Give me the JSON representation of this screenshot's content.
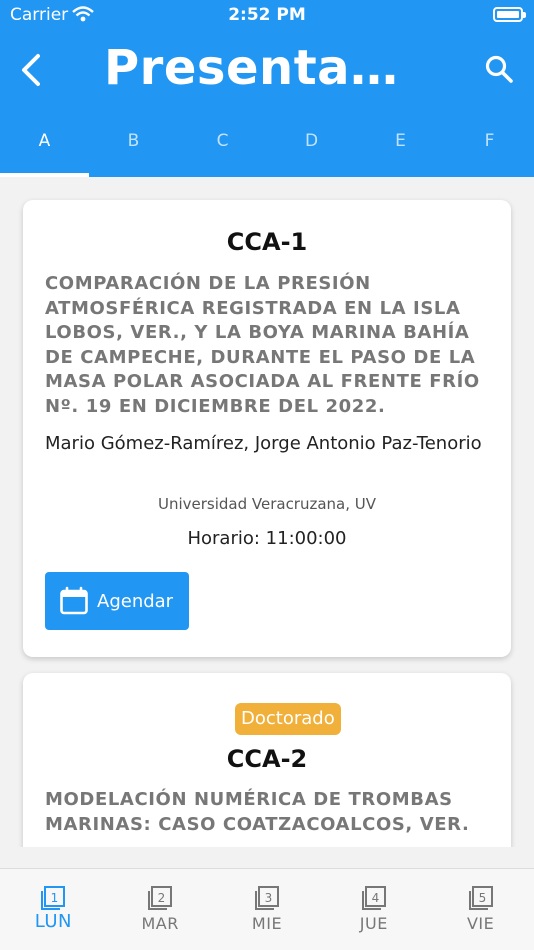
{
  "status_bar": {
    "carrier": "Carrier",
    "time": "2:52 PM"
  },
  "app_bar": {
    "title": "Presentaci…"
  },
  "tabs": [
    "A",
    "B",
    "C",
    "D",
    "E",
    "F"
  ],
  "cards": [
    {
      "code": "CCA-1",
      "title": "COMPARACIÓN DE LA PRESIÓN ATMOSFÉRICA REGISTRADA EN LA ISLA LOBOS, VER., Y LA BOYA MARINA BAHÍA DE CAMPECHE, DURANTE EL PASO DE LA MASA POLAR ASOCIADA AL FRENTE FRÍO Nº. 19 EN DICIEMBRE DEL 2022.",
      "authors": "Mario Gómez-Ramírez, Jorge Antonio Paz-Tenorio",
      "institution": "Universidad Veracruzana, UV",
      "schedule": "Horario: 11:00:00",
      "button_label": "Agendar"
    },
    {
      "badge": "Doctorado",
      "code": "CCA-2",
      "title": "MODELACIÓN NUMÉRICA DE TROMBAS MARINAS: CASO COATZACOALCOS, VER."
    }
  ],
  "bottom_nav": [
    {
      "label": "LUN",
      "num": "1"
    },
    {
      "label": "MAR",
      "num": "2"
    },
    {
      "label": "MIE",
      "num": "3"
    },
    {
      "label": "JUE",
      "num": "4"
    },
    {
      "label": "VIE",
      "num": "5"
    }
  ],
  "colors": {
    "primary": "#2196f3",
    "badge": "#f0b03a"
  }
}
